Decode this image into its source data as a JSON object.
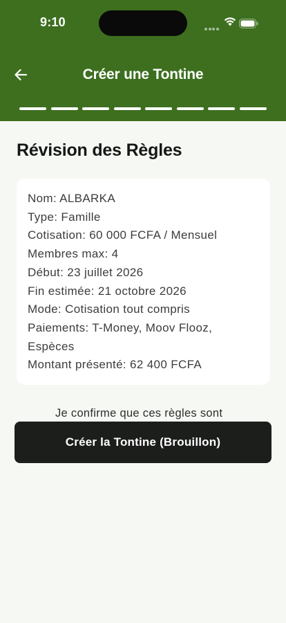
{
  "status_bar": {
    "time": "9:10",
    "icons": [
      "cellular-signal-icon",
      "wifi-icon",
      "battery-icon"
    ]
  },
  "header": {
    "title": "Créer une Tontine",
    "back_icon": "arrow-left-icon",
    "background_color": "#3d6f1f",
    "step_count": 8
  },
  "review": {
    "title": "Révision des Règles",
    "lines": [
      "Nom: ALBARKA",
      "Type: Famille",
      "Cotisation: 60 000 FCFA / Mensuel",
      "Membres max: 4",
      "Début: 23 juillet 2026",
      "Fin estimée: 21 octobre 2026",
      "Mode: Cotisation tout compris",
      "Paiements: T-Money, Moov Flooz,",
      "Espèces",
      "Montant présenté: 62 400 FCFA"
    ]
  },
  "confirmation": {
    "checked": true,
    "text": "Je confirme que ces règles sont exactes et seront partagées aux membres avant de démarrer."
  },
  "actions": {
    "create_label": "Créer la Tontine (Brouillon)"
  }
}
